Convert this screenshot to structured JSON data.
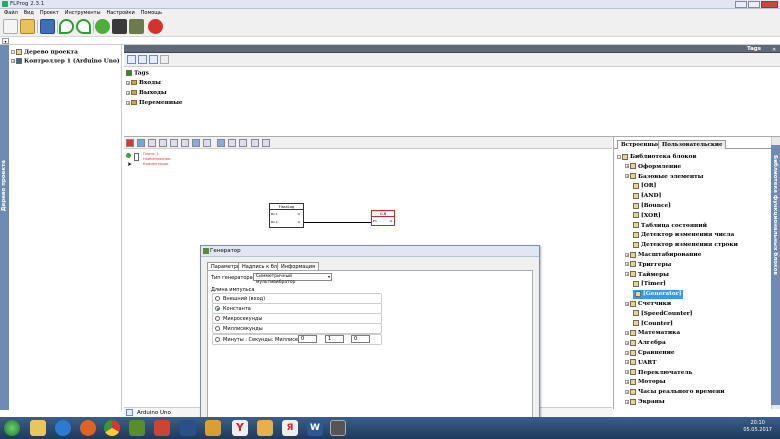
{
  "window": {
    "title": "FLProg 2.3.1"
  },
  "menu": [
    "Файл",
    "Вид",
    "Проект",
    "Инструменты",
    "Настройки",
    "Помощь"
  ],
  "left_tab": {
    "label": "Дерево проекта"
  },
  "tree": {
    "root": "Дерево проекта",
    "controller": "Контроллер 1 (Arduino Uno)"
  },
  "tags": {
    "header": "Tags",
    "root": "Tags",
    "items": [
      "Входы",
      "Выходы",
      "Переменные"
    ]
  },
  "canvas": {
    "board_legend": [
      "Плата: 1",
      "Наименование:",
      "Комментарии"
    ],
    "block1": {
      "title": "FlashLog",
      "in_pins": [
        "Вх.1",
        "Вх.2"
      ],
      "out_pins": [
        "Q",
        "Q"
      ]
    },
    "block2": {
      "title": "G-B",
      "pin_left": "En",
      "pin_right": "Q"
    }
  },
  "status": {
    "board": "Arduino Uno"
  },
  "library": {
    "tabs": [
      "Встроенные",
      "Пользовательские"
    ],
    "side_label": "Библиотека функциональных блоков",
    "items": [
      {
        "label": "Библиотека блоков",
        "indent": 0
      },
      {
        "label": "Оформление",
        "indent": 1
      },
      {
        "label": "Базовые элементы",
        "indent": 1
      },
      {
        "label": "[OR]",
        "indent": 2
      },
      {
        "label": "[AND]",
        "indent": 2
      },
      {
        "label": "[Bounce]",
        "indent": 2
      },
      {
        "label": "[XOR]",
        "indent": 2
      },
      {
        "label": "Таблица состояний",
        "indent": 2
      },
      {
        "label": "Детектор изменения числа",
        "indent": 2
      },
      {
        "label": "Детектор изменения строки",
        "indent": 2
      },
      {
        "label": "Масштабирование",
        "indent": 1
      },
      {
        "label": "Триггеры",
        "indent": 1
      },
      {
        "label": "Таймеры",
        "indent": 1
      },
      {
        "label": "[Timer]",
        "indent": 2
      },
      {
        "label": "[Generator]",
        "indent": 2,
        "selected": true
      },
      {
        "label": "Счетчики",
        "indent": 1
      },
      {
        "label": "[SpeedCounter]",
        "indent": 2
      },
      {
        "label": "[Counter]",
        "indent": 2
      },
      {
        "label": "Математика",
        "indent": 1
      },
      {
        "label": "Алгебра",
        "indent": 1
      },
      {
        "label": "Сравнение",
        "indent": 1
      },
      {
        "label": "UART",
        "indent": 1
      },
      {
        "label": "Переключатель",
        "indent": 1
      },
      {
        "label": "Моторы",
        "indent": 1
      },
      {
        "label": "Часы реального времени",
        "indent": 1
      },
      {
        "label": "Экраны",
        "indent": 1
      }
    ]
  },
  "dialog": {
    "title": "Генератор",
    "tabs": [
      "Параметры",
      "Надпись к блоку",
      "Информация"
    ],
    "gen_type_label": "Тип генератора:",
    "gen_type_value": "Симметричный мультивибратор",
    "pulse_length_label": "Длина импульса",
    "options": [
      "Внешний (вход)",
      "Константа",
      "Микросекунды",
      "Миллисекунды",
      "Минуты : Секунды: Миллисекунды"
    ],
    "selected_option": "Константа",
    "spin_values": [
      "0",
      "1",
      "0"
    ]
  },
  "taskbar": {
    "time": "20:10",
    "date": "05.05.2017"
  },
  "colors": {
    "accent": "#3399ff",
    "side_panel": "#6d8bb3",
    "taskbar": "#1d3a5c",
    "block_red": "#e02020"
  }
}
